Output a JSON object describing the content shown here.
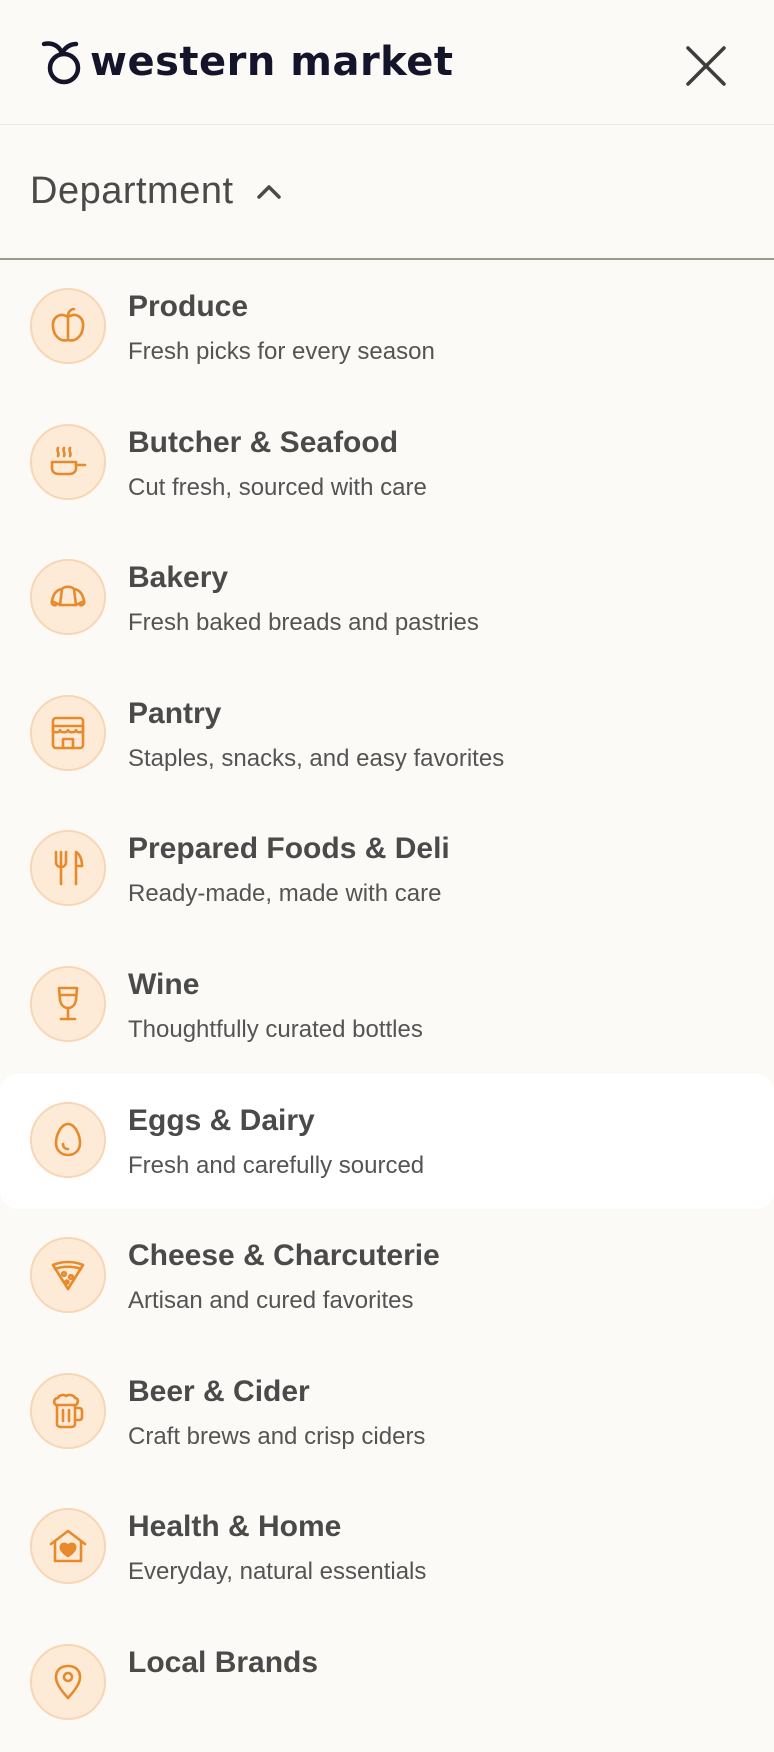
{
  "header": {
    "logo_text": "western market"
  },
  "department": {
    "title": "Department"
  },
  "colors": {
    "accent": "#e8892b",
    "icon_bg": "#fdebd8",
    "background": "#fcfaf6"
  },
  "items": [
    {
      "title": "Produce",
      "subtitle": "Fresh picks for every season",
      "icon": "apple-icon"
    },
    {
      "title": "Butcher & Seafood",
      "subtitle": "Cut fresh, sourced with care",
      "icon": "pan-icon"
    },
    {
      "title": "Bakery",
      "subtitle": "Fresh baked breads and pastries",
      "icon": "croissant-icon"
    },
    {
      "title": "Pantry",
      "subtitle": "Staples, snacks, and easy favorites",
      "icon": "storefront-icon"
    },
    {
      "title": "Prepared Foods & Deli",
      "subtitle": "Ready-made, made with care",
      "icon": "fork-knife-icon"
    },
    {
      "title": "Wine",
      "subtitle": "Thoughtfully curated bottles",
      "icon": "wine-glass-icon"
    },
    {
      "title": "Eggs & Dairy",
      "subtitle": "Fresh and carefully sourced",
      "icon": "egg-icon"
    },
    {
      "title": "Cheese & Charcuterie",
      "subtitle": "Artisan and cured favorites",
      "icon": "cheese-icon"
    },
    {
      "title": "Beer & Cider",
      "subtitle": "Craft brews and crisp ciders",
      "icon": "beer-mug-icon"
    },
    {
      "title": "Health & Home",
      "subtitle": "Everyday, natural essentials",
      "icon": "home-heart-icon"
    },
    {
      "title": "Local Brands",
      "subtitle": "",
      "icon": "location-pin-icon"
    }
  ]
}
